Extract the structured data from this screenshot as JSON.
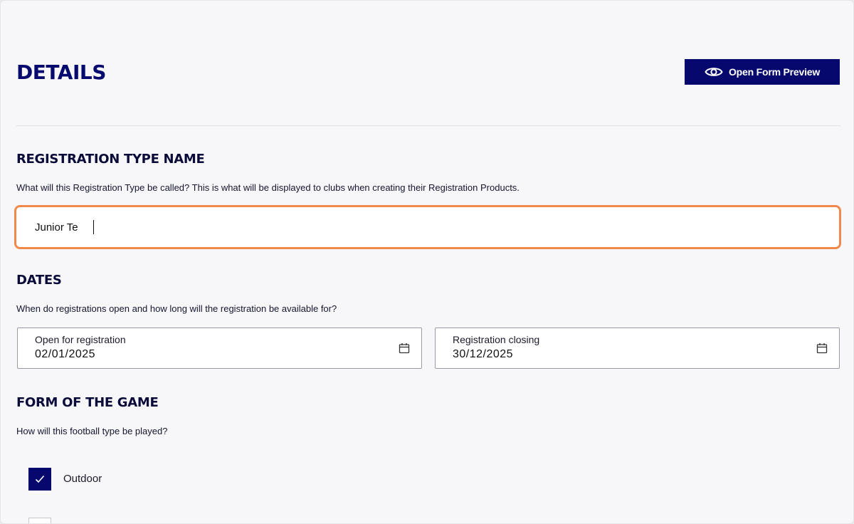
{
  "header": {
    "title": "DETAILS",
    "preview_button_label": "Open Form Preview",
    "preview_icon": "eye-icon"
  },
  "registration_type_name": {
    "title": "REGISTRATION TYPE NAME",
    "description": "What will this Registration Type be called? This is what will be displayed to clubs when creating their Registration Products.",
    "value": "Junior Te"
  },
  "dates": {
    "title": "DATES",
    "description": "When do registrations open and how long will the registration be available for?",
    "open": {
      "label": "Open for registration",
      "value": "02/01/2025",
      "icon": "calendar-icon"
    },
    "closing": {
      "label": "Registration closing",
      "value": "30/12/2025",
      "icon": "calendar-icon"
    }
  },
  "form_of_game": {
    "title": "FORM OF THE GAME",
    "description": "How will this football type be played?",
    "options": [
      {
        "label": "Outdoor",
        "checked": true
      }
    ]
  },
  "colors": {
    "primary": "#07086e",
    "focus_border": "#f08a4b",
    "background": "#f7f7fa"
  }
}
